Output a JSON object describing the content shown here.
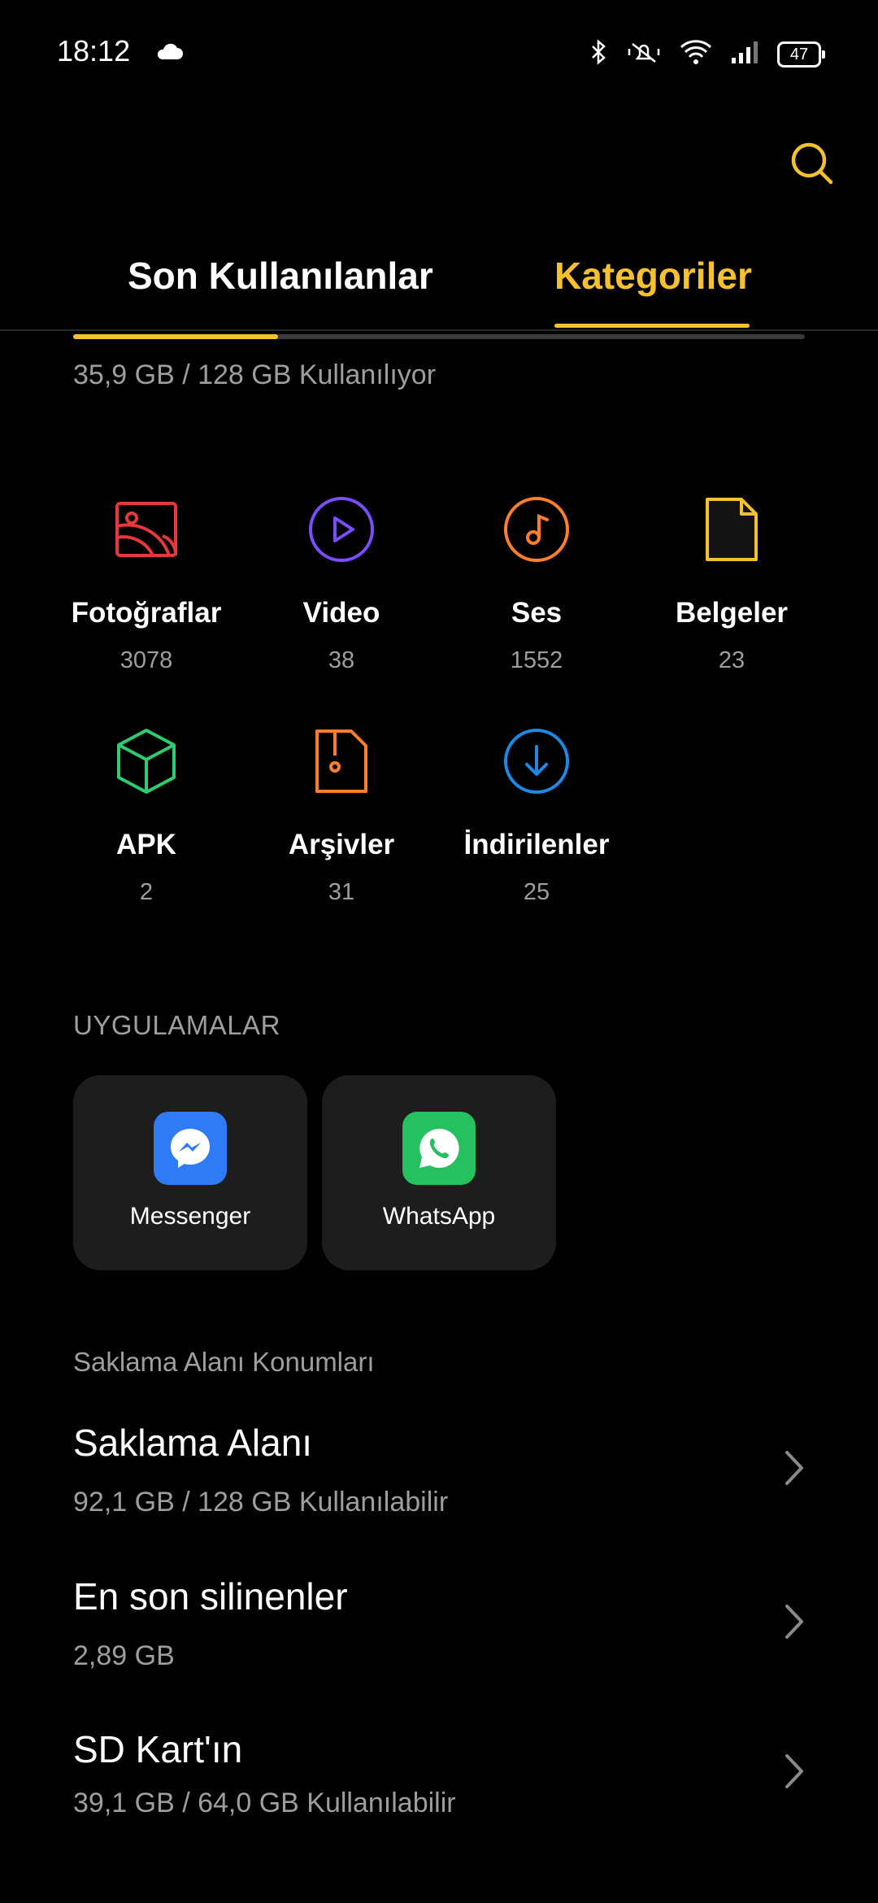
{
  "status_bar": {
    "time": "18:12",
    "battery": "47"
  },
  "tabs": [
    {
      "label": "Son Kullanılanlar",
      "active": false
    },
    {
      "label": "Kategoriler",
      "active": true
    }
  ],
  "storage": {
    "used_text": "35,9 GB / 128 GB Kullanılıyor",
    "used_fraction": 0.28
  },
  "categories": [
    {
      "name": "Fotoğraflar",
      "count": "3078",
      "icon": "photos-icon",
      "color": "#e5383b"
    },
    {
      "name": "Video",
      "count": "38",
      "icon": "video-icon",
      "color": "#7c4dff"
    },
    {
      "name": "Ses",
      "count": "1552",
      "icon": "audio-icon",
      "color": "#ff7f2a"
    },
    {
      "name": "Belgeler",
      "count": "23",
      "icon": "document-icon",
      "color": "#f5c12e"
    },
    {
      "name": "APK",
      "count": "2",
      "icon": "apk-icon",
      "color": "#2ecc71"
    },
    {
      "name": "Arşivler",
      "count": "31",
      "icon": "archive-icon",
      "color": "#ff7f2a"
    },
    {
      "name": "İndirilenler",
      "count": "25",
      "icon": "download-icon",
      "color": "#1e88e5"
    }
  ],
  "apps_section": {
    "title": "UYGULAMALAR",
    "apps": [
      {
        "label": "Messenger",
        "icon": "messenger-icon",
        "color": "#2f7bf6"
      },
      {
        "label": "WhatsApp",
        "icon": "whatsapp-icon",
        "color": "#25c05f"
      }
    ]
  },
  "storage_section": {
    "title": "Saklama Alanı Konumları",
    "locations": [
      {
        "title": "Saklama Alanı",
        "subtitle": "92,1 GB / 128 GB Kullanılabilir"
      },
      {
        "title": "En son silinenler",
        "subtitle": "2,89 GB"
      },
      {
        "title": "SD Kart'ın",
        "subtitle": "39,1 GB / 64,0 GB Kullanılabilir"
      }
    ]
  },
  "colors": {
    "accent": "#f5c12e",
    "background": "#000000",
    "card": "#1d1d1d",
    "muted_text": "#9e9e9e"
  }
}
